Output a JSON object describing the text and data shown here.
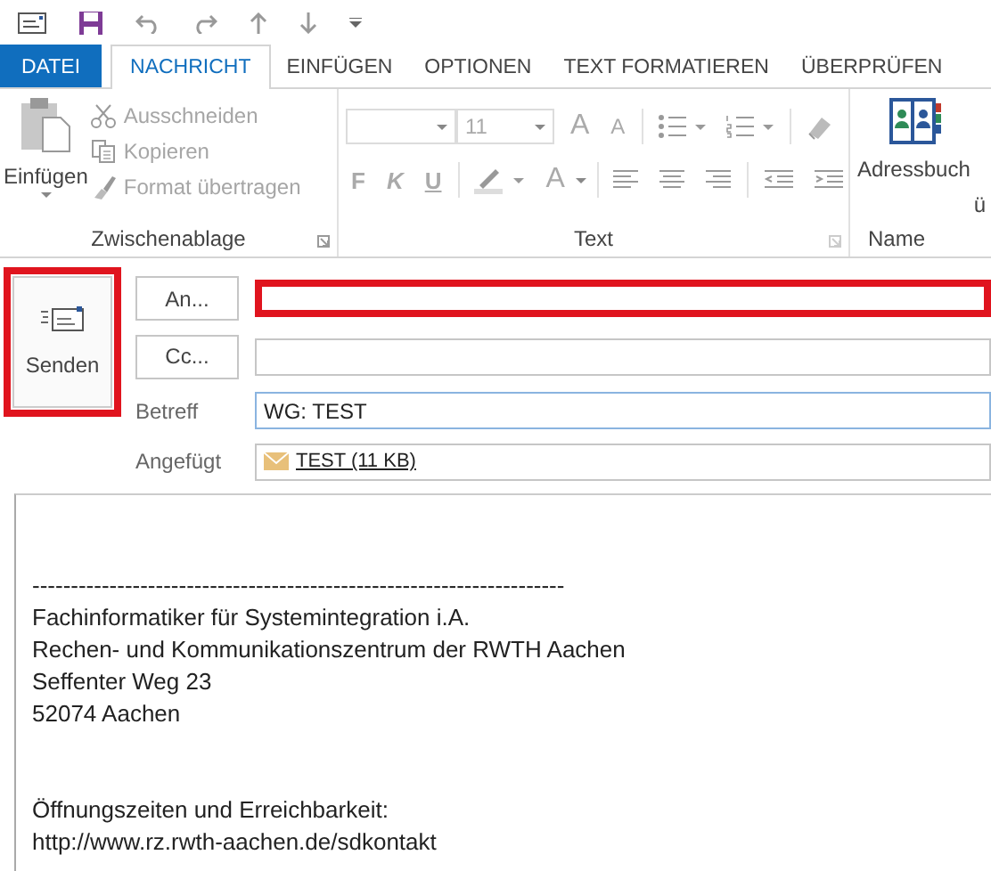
{
  "tabs": [
    {
      "label": "DATEI",
      "kind": "file",
      "selected": false
    },
    {
      "label": "NACHRICHT",
      "kind": "tab",
      "selected": true
    },
    {
      "label": "EINFÜGEN",
      "kind": "tab",
      "selected": false
    },
    {
      "label": "OPTIONEN",
      "kind": "tab",
      "selected": false
    },
    {
      "label": "TEXT FORMATIEREN",
      "kind": "tab",
      "selected": false
    },
    {
      "label": "ÜBERPRÜFEN",
      "kind": "tab",
      "selected": false
    }
  ],
  "ribbon": {
    "clipboard": {
      "label": "Zwischenablage",
      "paste": "Einfügen",
      "items": [
        {
          "label": "Ausschneiden",
          "disabled": true
        },
        {
          "label": "Kopieren",
          "disabled": true
        },
        {
          "label": "Format übertragen",
          "disabled": true
        }
      ]
    },
    "text": {
      "label": "Text",
      "size": "11",
      "grow_font": "A",
      "shrink_font": "A",
      "style_buttons": [
        "F",
        "K",
        "U"
      ],
      "font_color": "A"
    },
    "names": {
      "label": "Name",
      "address_book": "Adressbuch",
      "check_names": "ü"
    }
  },
  "compose": {
    "send": {
      "label": "Senden",
      "highlighted": true
    },
    "fields": [
      {
        "kind": "button",
        "button": "An...",
        "highlighted": true
      },
      {
        "kind": "button",
        "button": "Cc...",
        "highlighted": false
      },
      {
        "kind": "text",
        "label": "Betreff",
        "value": "WG: TEST",
        "focused": true
      },
      {
        "kind": "attachment",
        "label": "Angefügt",
        "attachment": "TEST (11 KB)"
      }
    ]
  },
  "body": {
    "blocks": [
      [
        "---------------------------------------------------------------------",
        "Fachinformatiker für Systemintegration i.A.",
        "Rechen- und Kommunikationszentrum der RWTH Aachen",
        "Seffenter Weg 23",
        "52074 Aachen"
      ],
      [
        "Öffnungszeiten und Erreichbarkeit:",
        "http://www.rz.rwth-aachen.de/sdkontakt"
      ]
    ]
  }
}
